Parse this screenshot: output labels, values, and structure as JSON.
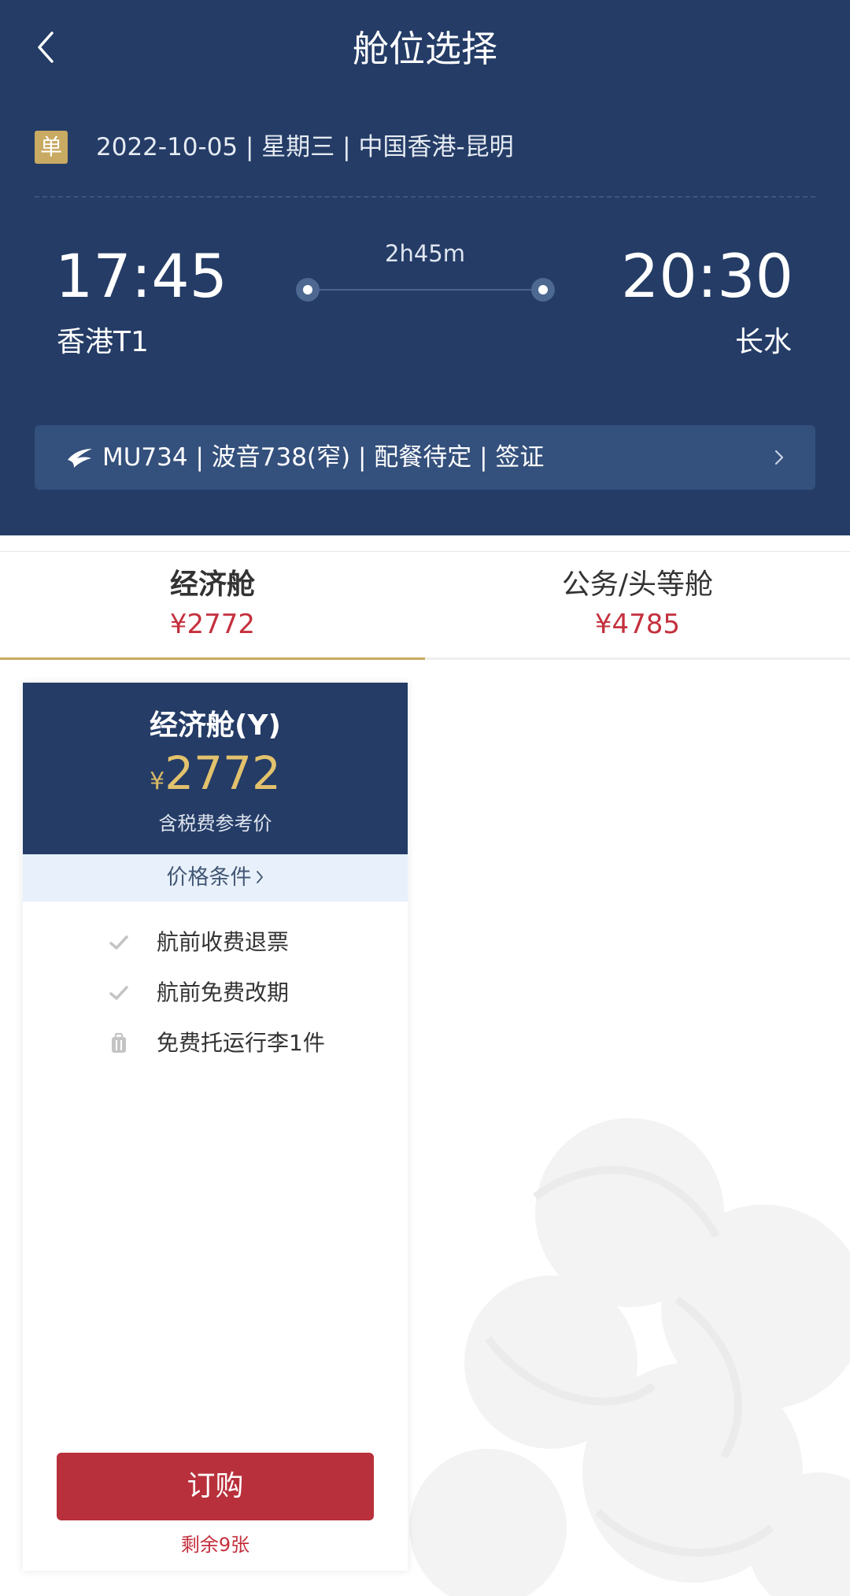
{
  "header": {
    "title": "舱位选择",
    "trip_badge": "单",
    "trip_info": "2022-10-05 | 星期三 | 中国香港-昆明"
  },
  "flight": {
    "departure_time": "17:45",
    "arrival_time": "20:30",
    "duration": "2h45m",
    "departure_airport": "香港T1",
    "arrival_airport": "长水",
    "details": "MU734 | 波音738(窄) | 配餐待定 | 签证"
  },
  "tabs": [
    {
      "name": "经济舱",
      "price": "¥2772",
      "active": true
    },
    {
      "name": "公务/头等舱",
      "price": "¥4785",
      "active": false
    }
  ],
  "card": {
    "cabin_name": "经济舱(Y)",
    "currency": "¥",
    "price": "2772",
    "price_note": "含税费参考价",
    "conditions_label": "价格条件",
    "features": [
      {
        "icon": "check-icon",
        "text": "航前收费退票"
      },
      {
        "icon": "check-icon",
        "text": "航前免费改期"
      },
      {
        "icon": "luggage-icon",
        "text": "免费托运行李1件"
      }
    ],
    "buy_label": "订购",
    "remaining": "剩余9张"
  },
  "colors": {
    "header_bg": "#243c66",
    "accent_gold": "#c9aa62",
    "price_red": "#c4303d",
    "buy_button": "#b8303b"
  }
}
